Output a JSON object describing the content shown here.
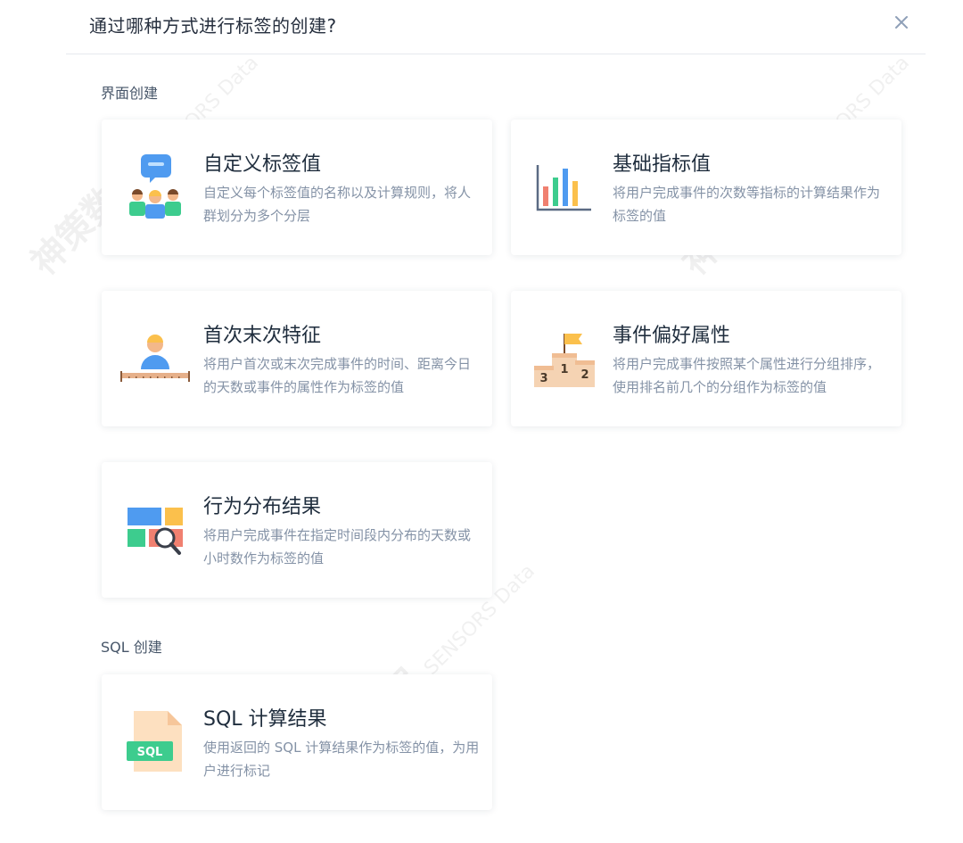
{
  "dialog": {
    "title": "通过哪种方式进行标签的创建?",
    "close_label": "×"
  },
  "sections": [
    {
      "label": "界面创建",
      "cards": [
        {
          "title": "自定义标签值",
          "description": "自定义每个标签值的名称以及计算规则，将人群划分为多个分层",
          "icon": "people-group-icon"
        },
        {
          "title": "基础指标值",
          "description": "将用户完成事件的次数等指标的计算结果作为标签的值",
          "icon": "bar-chart-icon"
        },
        {
          "title": "首次末次特征",
          "description": "将用户首次或末次完成事件的时间、距离今日的天数或事件的属性作为标签的值",
          "icon": "user-timeline-icon"
        },
        {
          "title": "事件偏好属性",
          "description": "将用户完成事件按照某个属性进行分组排序，使用排名前几个的分组作为标签的值",
          "icon": "podium-icon"
        },
        {
          "title": "行为分布结果",
          "description": "将用户完成事件在指定时间段内分布的天数或小时数作为标签的值",
          "icon": "distribution-search-icon"
        }
      ]
    },
    {
      "label": "SQL 创建",
      "cards": [
        {
          "title": "SQL 计算结果",
          "description": "使用返回的 SQL 计算结果作为标签的值，为用户进行标记",
          "icon": "sql-file-icon",
          "badge": "SQL"
        }
      ]
    }
  ],
  "podium_numbers": [
    "3",
    "1",
    "2"
  ],
  "watermark": {
    "brand": "神策数据",
    "brand_en": "SENSORS Data"
  },
  "colors": {
    "blue": "#4f9bf0",
    "green": "#3dcc8e",
    "yellow": "#fbc04c",
    "red": "#f08070",
    "accent": "#5b6b84"
  }
}
